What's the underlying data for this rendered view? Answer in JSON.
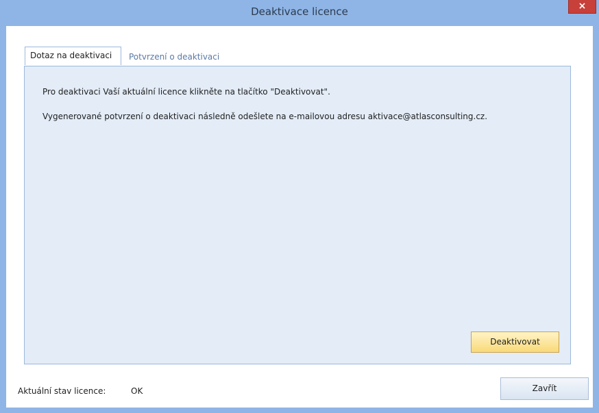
{
  "window": {
    "title": "Deaktivace licence",
    "close_label": "×"
  },
  "tabs": [
    {
      "label": "Dotaz na deaktivaci",
      "active": true
    },
    {
      "label": "Potvrzení o deaktivaci",
      "active": false
    }
  ],
  "panel": {
    "line1": "Pro deaktivaci Vaší aktuální licence klikněte na tlačítko \"Deaktivovat\".",
    "line2": "Vygenerované potvrzení o deaktivaci následně odešlete na e-mailovou adresu aktivace@atlasconsulting.cz.",
    "deactivate_label": "Deaktivovat"
  },
  "footer": {
    "status_label": "Aktuální stav licence:",
    "status_value": "OK",
    "close_label": "Zavřít"
  }
}
